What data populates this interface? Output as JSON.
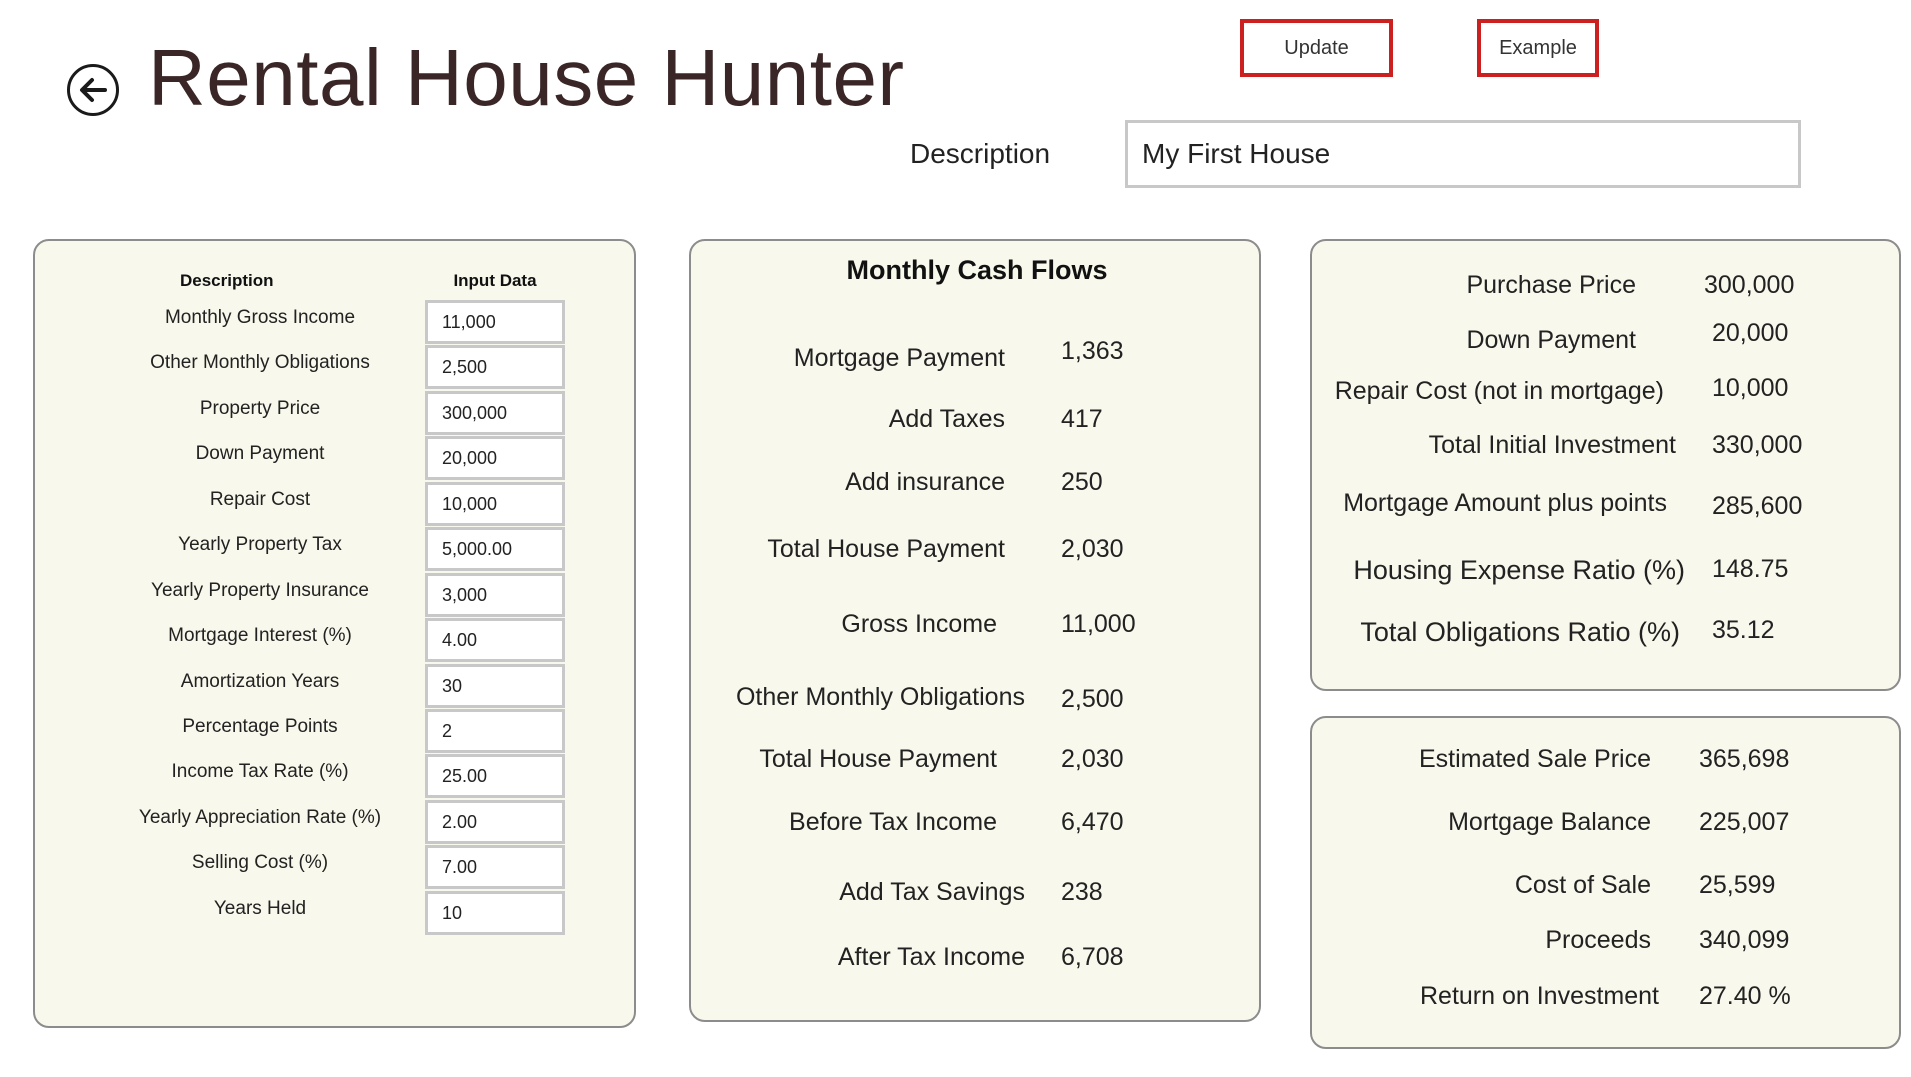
{
  "header": {
    "title": "Rental House Hunter",
    "update_label": "Update",
    "example_label": "Example",
    "description_label": "Description",
    "description_value": "My First House"
  },
  "inputs": {
    "col_description": "Description",
    "col_input": "Input Data",
    "rows": [
      {
        "label": "Monthly Gross Income",
        "value": "11,000"
      },
      {
        "label": "Other Monthly Obligations",
        "value": "2,500"
      },
      {
        "label": "Property Price",
        "value": "300,000"
      },
      {
        "label": "Down Payment",
        "value": "20,000"
      },
      {
        "label": "Repair Cost",
        "value": "10,000"
      },
      {
        "label": "Yearly Property Tax",
        "value": "5,000.00"
      },
      {
        "label": "Yearly Property Insurance",
        "value": "3,000"
      },
      {
        "label": "Mortgage Interest (%)",
        "value": "4.00"
      },
      {
        "label": "Amortization Years",
        "value": "30"
      },
      {
        "label": "Percentage Points",
        "value": "2"
      },
      {
        "label": "Income Tax Rate (%)",
        "value": "25.00"
      },
      {
        "label": "Yearly Appreciation Rate (%)",
        "value": "2.00"
      },
      {
        "label": "Selling Cost (%)",
        "value": "7.00"
      },
      {
        "label": "Years Held",
        "value": "10"
      }
    ]
  },
  "cashflows": {
    "title": "Monthly Cash Flows",
    "rows": [
      {
        "label": "Mortgage Payment",
        "value": "1,363"
      },
      {
        "label": "Add Taxes",
        "value": "417"
      },
      {
        "label": "Add insurance",
        "value": "250"
      },
      {
        "label": "Total House Payment",
        "value": "2,030"
      },
      {
        "label": "Gross Income",
        "value": "11,000"
      },
      {
        "label": "Other Monthly Obligations",
        "value": "2,500"
      },
      {
        "label": "Total House Payment",
        "value": "2,030"
      },
      {
        "label": "Before Tax Income",
        "value": "6,470"
      },
      {
        "label": "Add Tax Savings",
        "value": "238"
      },
      {
        "label": "After Tax Income",
        "value": "6,708"
      }
    ]
  },
  "investment": {
    "rows": [
      {
        "label": "Purchase Price",
        "value": "300,000"
      },
      {
        "label": "Down Payment",
        "value": "20,000"
      },
      {
        "label": "Repair Cost (not in mortgage)",
        "value": "10,000"
      },
      {
        "label": "Total Initial Investment",
        "value": "330,000"
      },
      {
        "label": "Mortgage Amount  plus points",
        "value": "285,600"
      },
      {
        "label": "Housing Expense Ratio (%)",
        "value": "148.75"
      },
      {
        "label": "Total Obligations Ratio (%)",
        "value": "35.12"
      }
    ]
  },
  "sale": {
    "rows": [
      {
        "label": "Estimated Sale Price",
        "value": "365,698"
      },
      {
        "label": "Mortgage Balance",
        "value": "225,007"
      },
      {
        "label": "Cost of Sale",
        "value": "25,599"
      },
      {
        "label": "Proceeds",
        "value": "340,099"
      },
      {
        "label": "Return on Investment",
        "value": "27.40 %"
      }
    ]
  }
}
